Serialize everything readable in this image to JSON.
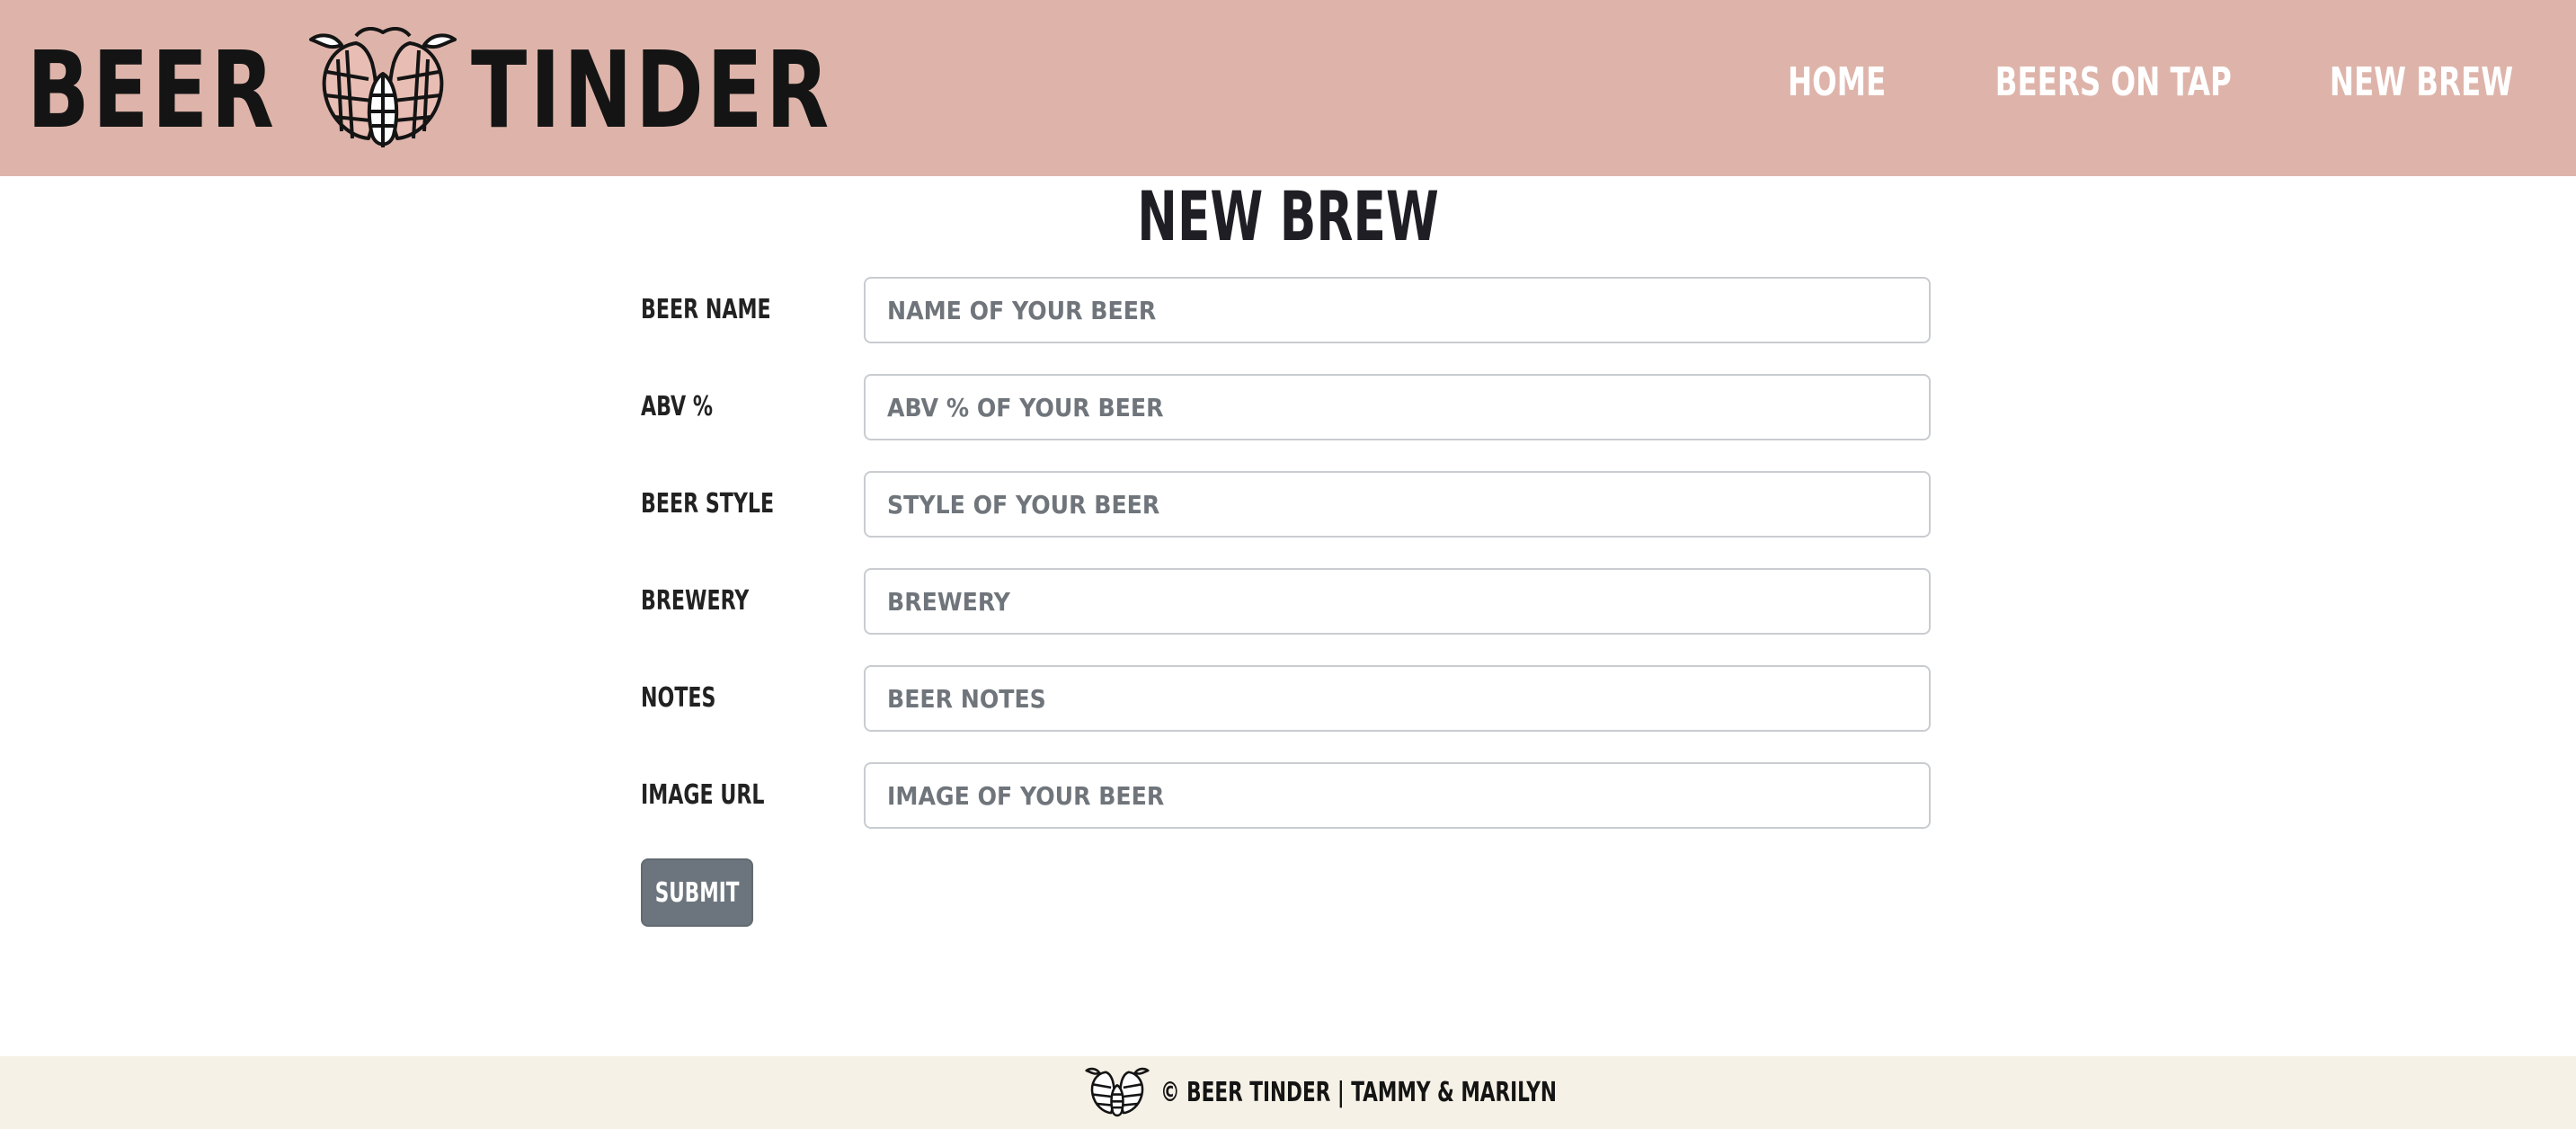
{
  "brand": {
    "word_left": "BEER",
    "word_right": "TINDER",
    "logo_icon": "hops-logo-icon"
  },
  "nav": {
    "home": "HOME",
    "beers_on_tap": "BEERS ON TAP",
    "new_brew": "NEW BREW"
  },
  "page": {
    "title": "NEW BREW"
  },
  "form": {
    "fields": [
      {
        "label": "BEER NAME",
        "placeholder": "NAME OF YOUR BEER",
        "value": ""
      },
      {
        "label": "ABV %",
        "placeholder": "ABV % OF YOUR BEER",
        "value": ""
      },
      {
        "label": "BEER STYLE",
        "placeholder": "STYLE OF YOUR BEER",
        "value": ""
      },
      {
        "label": "BREWERY",
        "placeholder": "BREWERY",
        "value": ""
      },
      {
        "label": "NOTES",
        "placeholder": "BEER NOTES",
        "value": ""
      },
      {
        "label": "IMAGE URL",
        "placeholder": "IMAGE OF YOUR BEER",
        "value": ""
      }
    ],
    "submit_label": "SUBMIT"
  },
  "footer": {
    "text": "© BEER TINDER | TAMMY & MARILYN",
    "logo_icon": "hops-logo-icon"
  },
  "colors": {
    "navbar_bg": "#deb4aa",
    "footer_bg": "#f6f1e6",
    "submit_bg": "#6c757d",
    "nav_text": "#ffffff"
  }
}
